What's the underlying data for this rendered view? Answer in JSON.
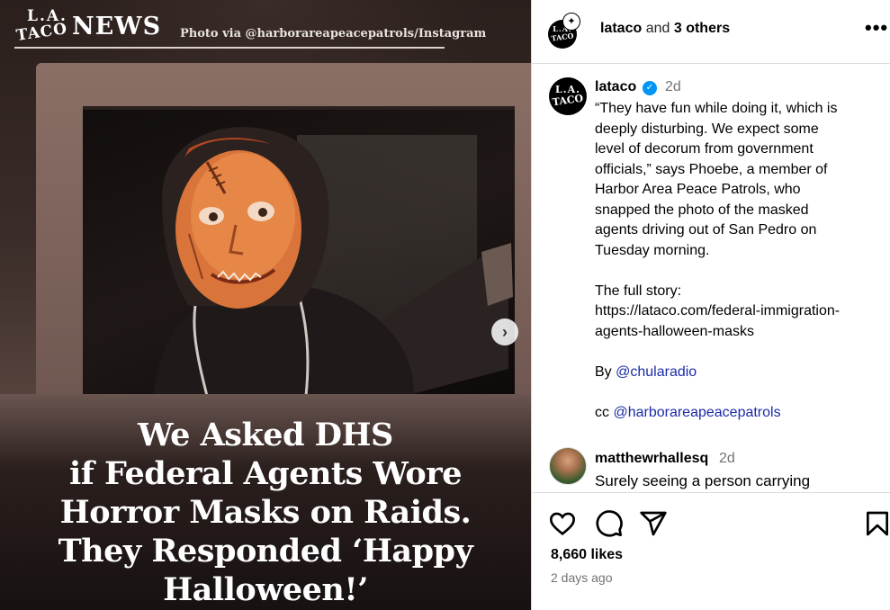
{
  "media": {
    "brand_logo_line1": "L.A.",
    "brand_logo_line2": "TACO",
    "brand_news": "NEWS",
    "photo_credit": "Photo via @harborareapeacepatrols/Instagram",
    "next_arrow": "›",
    "headline_lines": [
      "We Asked DHS",
      "if Federal Agents Wore",
      "Horror Masks on Raids.",
      "They Responded ‘Happy",
      "Halloween!’"
    ]
  },
  "header": {
    "username": "lataco",
    "and_text": "and",
    "others": "3 others",
    "more": "•••",
    "badge_icon": "collab-badge-icon"
  },
  "caption": {
    "username": "lataco",
    "verified_mark": "✓",
    "time": "2d",
    "lines": [
      "“They have fun while doing it, which is",
      "deeply disturbing. We expect some",
      "level of decorum from government",
      "officials,” says Phoebe, a member of",
      "Harbor Area Peace Patrols, who",
      "snapped the photo of the masked",
      "agents driving out of San Pedro on",
      "Tuesday morning."
    ],
    "full_story_label": "The full story:",
    "url_line1": "https://lataco.com/federal-immigration-",
    "url_line2": "agents-halloween-masks",
    "by_label": "By",
    "by_mention": "@chularadio",
    "cc_label": "cc",
    "cc_mention": "@harborareapeacepatrols"
  },
  "comment": {
    "username": "matthewrhallesq",
    "time": "2d",
    "text": "Surely seeing a person carrying"
  },
  "footer": {
    "likes": "8,660 likes",
    "age": "2 days ago"
  },
  "colors": {
    "verified_blue": "#0095f6",
    "mention_blue": "#1b2ba8",
    "muted_gray": "#737373"
  }
}
